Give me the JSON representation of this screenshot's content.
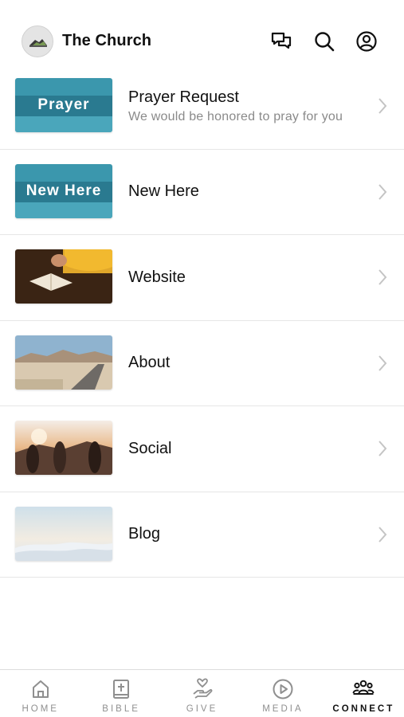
{
  "header": {
    "title": "The Church",
    "avatar_icon": "church-logo",
    "actions": [
      {
        "name": "chat-icon"
      },
      {
        "name": "search-icon"
      },
      {
        "name": "profile-icon"
      }
    ]
  },
  "items": [
    {
      "title": "Prayer Request",
      "subtitle": "We would be honored to pray for you",
      "thumb_text": "Prayer"
    },
    {
      "title": "New Here",
      "subtitle": "",
      "thumb_text": "New Here"
    },
    {
      "title": "Website",
      "subtitle": "",
      "thumb_text": ""
    },
    {
      "title": "About",
      "subtitle": "",
      "thumb_text": ""
    },
    {
      "title": "Social",
      "subtitle": "",
      "thumb_text": ""
    },
    {
      "title": "Blog",
      "subtitle": "",
      "thumb_text": ""
    }
  ],
  "tabs": [
    {
      "label": "HOME",
      "icon": "home-icon",
      "active": false
    },
    {
      "label": "BIBLE",
      "icon": "bible-icon",
      "active": false
    },
    {
      "label": "GIVE",
      "icon": "give-icon",
      "active": false
    },
    {
      "label": "MEDIA",
      "icon": "play-icon",
      "active": false
    },
    {
      "label": "CONNECT",
      "icon": "people-icon",
      "active": true
    }
  ],
  "colors": {
    "accent_teal": "#2f8ba3",
    "inactive_tab": "#8f8f8f",
    "active_tab": "#111111"
  }
}
